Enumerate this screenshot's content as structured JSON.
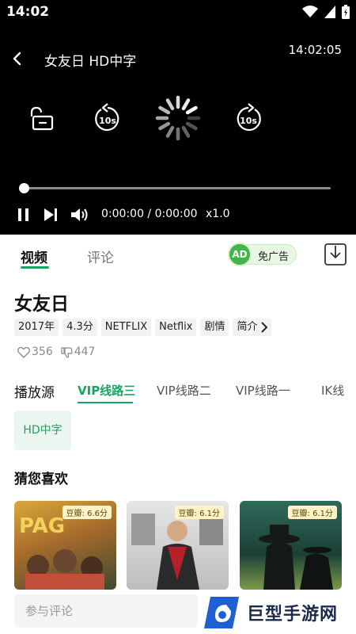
{
  "status_bar": {
    "time": "14:02"
  },
  "player": {
    "title": "女友日 HD中字",
    "clock": "14:02:05",
    "rewind_label": "10s",
    "forward_label": "10s",
    "progress": 0,
    "time_text": "0:00:00 / 0:00:00",
    "speed": "x1.0"
  },
  "tabs": [
    {
      "label": "视频",
      "active": true
    },
    {
      "label": "评论",
      "active": false
    }
  ],
  "ad": {
    "badge": "AD",
    "label": "免广告"
  },
  "movie": {
    "title": "女友日",
    "tags": [
      "2017年",
      "4.3分",
      "NETFLIX",
      "Netflix",
      "剧情"
    ],
    "intro_label": "简介",
    "likes": "356",
    "dislikes": "447"
  },
  "sources": {
    "label": "播放源",
    "items": [
      "VIP线路三",
      "VIP线路二",
      "VIP线路一",
      "IK线"
    ],
    "active_index": 0
  },
  "episodes": [
    "HD中字"
  ],
  "recommend": {
    "title": "猜您喜欢",
    "items": [
      {
        "rating": "豆瓣: 6.6分"
      },
      {
        "rating": "豆瓣: 6.1分"
      },
      {
        "rating": "豆瓣: 6.1分"
      }
    ]
  },
  "comment": {
    "placeholder": "参与评论"
  },
  "watermark": {
    "text": "巨型手游网"
  },
  "colors": {
    "accent": "#19a463",
    "player_bg": "#000000"
  }
}
